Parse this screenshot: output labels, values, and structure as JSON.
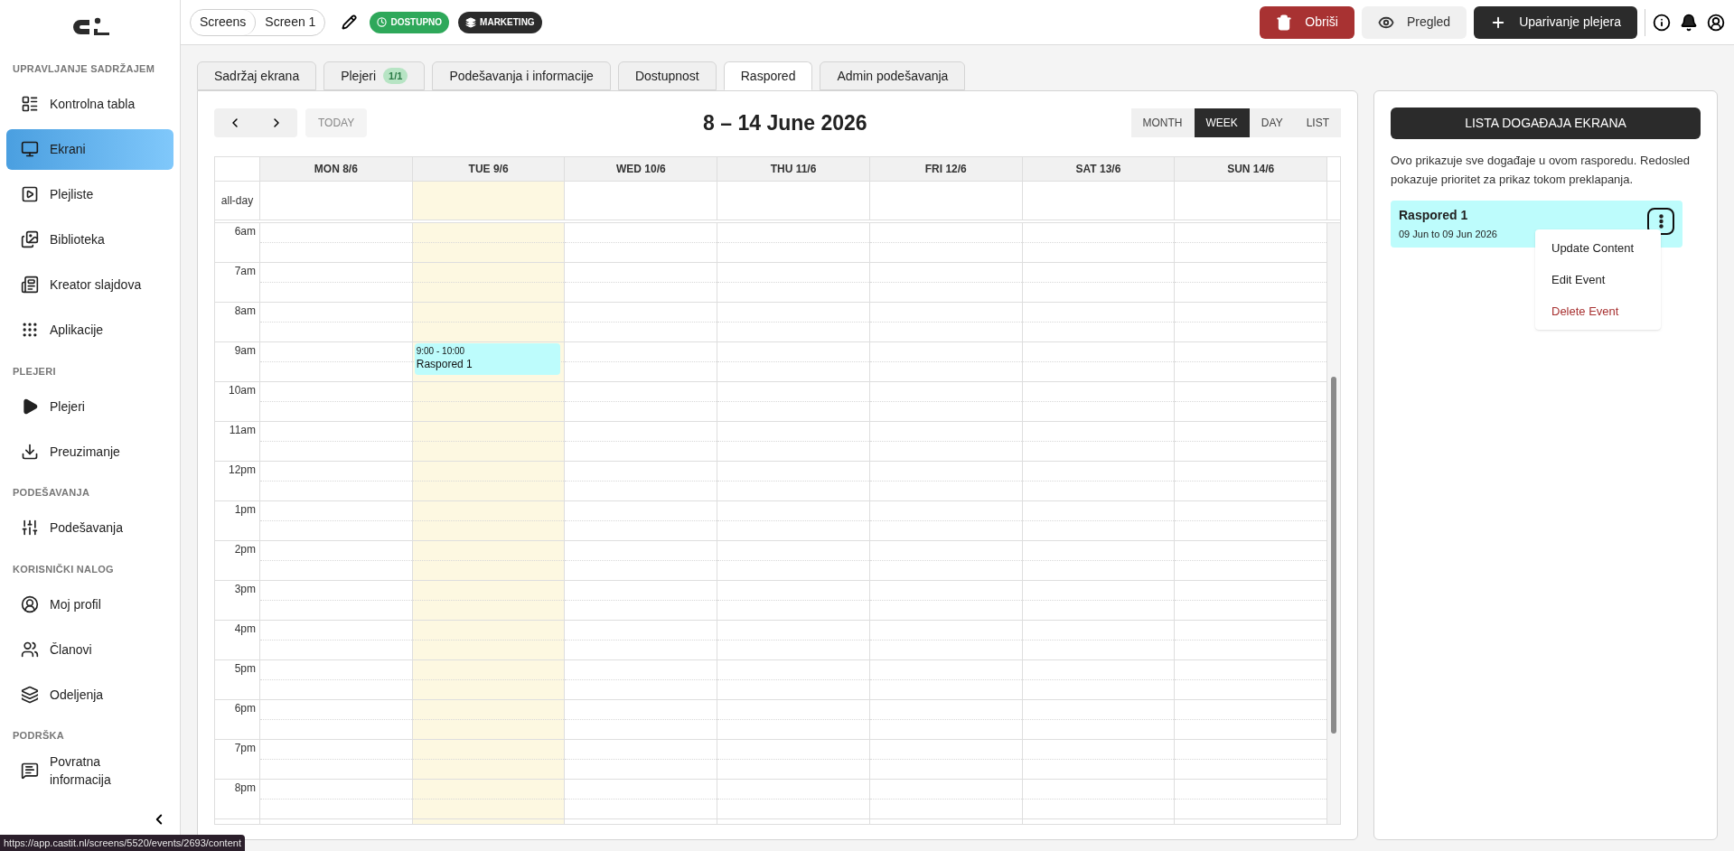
{
  "sidebar": {
    "sections": [
      {
        "title": "UPRAVLJANJE SADRŽAJEM",
        "items": [
          {
            "label": "Kontrolna tabla",
            "selected": false
          },
          {
            "label": "Ekrani",
            "selected": true
          },
          {
            "label": "Plejliste",
            "selected": false
          },
          {
            "label": "Biblioteka",
            "selected": false
          },
          {
            "label": "Kreator slajdova",
            "selected": false
          },
          {
            "label": "Aplikacije",
            "selected": false
          }
        ]
      },
      {
        "title": "PLEJERI",
        "items": [
          {
            "label": "Plejeri",
            "selected": false
          },
          {
            "label": "Preuzimanje",
            "selected": false
          }
        ]
      },
      {
        "title": "PODEŠAVANJA",
        "items": [
          {
            "label": "Podešavanja",
            "selected": false
          }
        ]
      },
      {
        "title": "KORISNIČKI NALOG",
        "items": [
          {
            "label": "Moj profil",
            "selected": false
          },
          {
            "label": "Članovi",
            "selected": false
          },
          {
            "label": "Odeljenja",
            "selected": false
          }
        ]
      },
      {
        "title": "PODRŠKA",
        "items": [
          {
            "label": "Povratna informacija",
            "selected": false
          }
        ]
      }
    ]
  },
  "topbar": {
    "breadcrumbs": [
      "Screens",
      "Screen 1"
    ],
    "badges": [
      {
        "label": "DOSTUPNO",
        "kind": "status"
      },
      {
        "label": "MARKETING",
        "kind": "department"
      }
    ],
    "buttons": [
      {
        "label": "Obriši",
        "kind": "danger"
      },
      {
        "label": "Pregled",
        "kind": "secondary"
      },
      {
        "label": "Uparivanje plejera",
        "kind": "primary"
      }
    ]
  },
  "tabs": [
    {
      "label": "Sadržaj ekrana",
      "selected": false
    },
    {
      "label": "Plejeri",
      "badge": "1/1",
      "selected": false
    },
    {
      "label": "Podešavanja i informacije",
      "selected": false
    },
    {
      "label": "Dostupnost",
      "selected": false
    },
    {
      "label": "Raspored",
      "selected": true
    },
    {
      "label": "Admin podešavanja",
      "selected": false
    }
  ],
  "calendar": {
    "today_button": "TODAY",
    "title": "8 – 14 June 2026",
    "views": [
      {
        "label": "MONTH",
        "selected": false
      },
      {
        "label": "WEEK",
        "selected": true
      },
      {
        "label": "DAY",
        "selected": false
      },
      {
        "label": "LIST",
        "selected": false
      }
    ],
    "all_day_label": "all-day",
    "days": [
      {
        "label": "MON 8/6",
        "today": false
      },
      {
        "label": "TUE 9/6",
        "today": true,
        "events": [
          {
            "time": "9:00 - 10:00",
            "title": "Raspored 1"
          }
        ]
      },
      {
        "label": "WED 10/6",
        "today": false
      },
      {
        "label": "THU 11/6",
        "today": false
      },
      {
        "label": "FRI 12/6",
        "today": false
      },
      {
        "label": "SAT 13/6",
        "today": false
      },
      {
        "label": "SUN 14/6",
        "today": false
      }
    ],
    "hours": [
      "6am",
      "7am",
      "8am",
      "9am",
      "10am",
      "11am",
      "12pm",
      "1pm",
      "2pm",
      "3pm",
      "4pm",
      "5pm",
      "6pm",
      "7pm",
      "8pm"
    ]
  },
  "event_list": {
    "header": "LISTA DOGAĐAJA EKRANA",
    "description": "Ovo prikazuje sve događaje u ovom rasporedu. Redosled pokazuje prioritet za prikaz tokom preklapanja.",
    "events": [
      {
        "title": "Raspored 1",
        "dates": "09 Jun to 09 Jun 2026",
        "menu_open": true
      }
    ],
    "menu": [
      {
        "label": "Update Content",
        "kind": "normal"
      },
      {
        "label": "Edit Event",
        "kind": "normal"
      },
      {
        "label": "Delete Event",
        "kind": "danger"
      }
    ]
  },
  "status_bar": {
    "url": "https://app.castit.nl/screens/5520/events/2693/content"
  }
}
